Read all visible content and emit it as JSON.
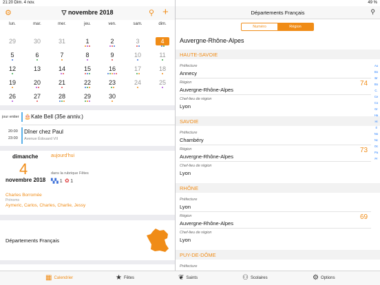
{
  "status": {
    "time_date": "21:20  Dim. 4 nov.",
    "battery": "49 %"
  },
  "calendar": {
    "title": "▽ novembre 2018",
    "weekdays": [
      "lun.",
      "mar.",
      "mer.",
      "jeu.",
      "ven.",
      "sam.",
      "dim."
    ],
    "weeks": [
      [
        "29",
        "30",
        "31",
        "1",
        "2",
        "3",
        "4"
      ],
      [
        "5",
        "6",
        "7",
        "8",
        "9",
        "10",
        "11"
      ],
      [
        "12",
        "13",
        "14",
        "15",
        "16",
        "17",
        "18"
      ],
      [
        "19",
        "20",
        "21",
        "22",
        "23",
        "24",
        "25"
      ],
      [
        "26",
        "27",
        "28",
        "29",
        "30",
        "",
        ""
      ]
    ],
    "today": "4",
    "colors": {
      "accent": "#f08c17"
    }
  },
  "events": {
    "all_day_label": "jour entier",
    "all_day_title": "Kate Bell (35e anniv.)",
    "timed_label": "20:00",
    "timed_end": "23:00",
    "timed_title": "Dîner chez Paul",
    "timed_location": "Avenue Édouard VII"
  },
  "day_card": {
    "weekday": "dimanche",
    "today_link": "aujourd'hui",
    "number": "4",
    "month": "novembre 2018",
    "rubrique": "dans la rubrique Fêtes",
    "counts": "1      1",
    "saint": "Charles Borromée",
    "prenoms_label": "Prénoms",
    "prenoms": "Aymeric, Carlos, Charles, Charlie, Jessy"
  },
  "dept_card": {
    "label": "Départements Français"
  },
  "tabs": [
    {
      "label": "Calendrier",
      "icon": "calendar-icon",
      "active": true
    },
    {
      "label": "Fêtes",
      "icon": "star-icon"
    },
    {
      "label": "Saints",
      "icon": "laurel-icon"
    },
    {
      "label": "Scolaires",
      "icon": "students-icon"
    },
    {
      "label": "Options",
      "icon": "gear-icon"
    }
  ],
  "right": {
    "title": "Départements Français",
    "segments": [
      "Numéro",
      "Région"
    ],
    "selected_segment": "Région",
    "region": "Auvergne-Rhône-Alpes",
    "departments": [
      {
        "name": "HAUTE-SAVOIE",
        "prefecture_label": "Préfecture",
        "prefecture": "Annecy",
        "region_label": "Région",
        "region": "Auvergne-Rhône-Alpes",
        "chef_label": "Chef-lieu de région",
        "chef": "Lyon",
        "number": "74"
      },
      {
        "name": "SAVOIE",
        "prefecture_label": "Préfecture",
        "prefecture": "Chambéry",
        "region_label": "Région",
        "region": "Auvergne-Rhône-Alpes",
        "chef_label": "Chef-lieu de région",
        "chef": "Lyon",
        "number": "73"
      },
      {
        "name": "RHÔNE",
        "prefecture_label": "Préfecture",
        "prefecture": "Lyon",
        "region_label": "Région",
        "region": "Auvergne-Rhône-Alpes",
        "chef_label": "Chef-lieu de région",
        "chef": "Lyon",
        "number": "69"
      },
      {
        "name": "PUY-DE-DÔME",
        "prefecture_label": "Préfecture"
      }
    ],
    "index": [
      "Au",
      "Bo",
      "Br",
      "Bo",
      "C.",
      "Ce",
      "Co",
      "Gr",
      "Ha",
      "Hi",
      "Il",
      "No",
      "Nc",
      "Oc",
      "Pa",
      "Pr"
    ]
  }
}
